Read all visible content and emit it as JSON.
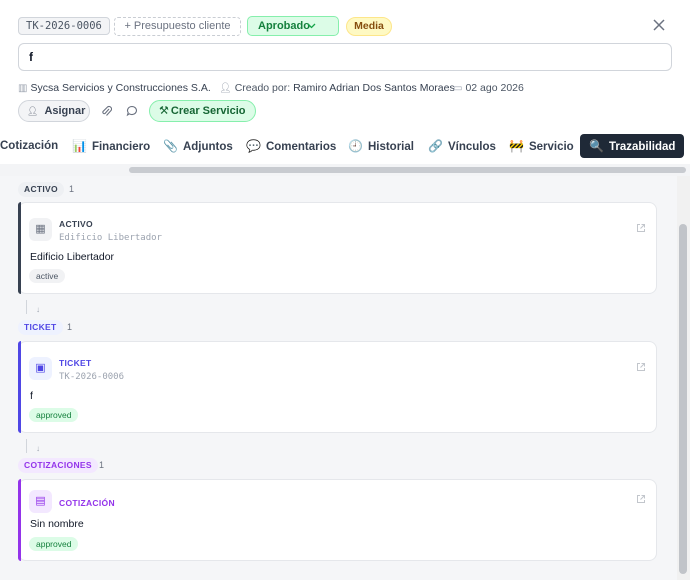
{
  "header": {
    "ticket_id": "TK-2026-0006",
    "budget_chip": "+ Presupuesto cliente",
    "status": "Aprobado",
    "priority": "Media",
    "title_value": "f",
    "company": "Sycsa Servicios y Construcciones S.A.",
    "created_by_label": "Creado por:",
    "created_by": "Ramiro Adrian Dos Santos Moraes",
    "date": "02 ago 2026",
    "assign_label": "Asignar",
    "create_service_label": "Crear Servicio"
  },
  "tabs": [
    {
      "label": "Cotización",
      "icon": ""
    },
    {
      "label": "Financiero",
      "icon": "📊"
    },
    {
      "label": "Adjuntos",
      "icon": "📎"
    },
    {
      "label": "Comentarios",
      "icon": "💬"
    },
    {
      "label": "Historial",
      "icon": "🕘"
    },
    {
      "label": "Vínculos",
      "icon": "🔗"
    },
    {
      "label": "Servicio",
      "icon": "🚧"
    },
    {
      "label": "Trazabilidad",
      "icon": "🔍"
    }
  ],
  "active_tab": "Trazabilidad",
  "sections": [
    {
      "label": "ACTIVO",
      "count": "1",
      "card": {
        "type": "ACTIVO",
        "code": "Edificio Libertador",
        "name": "Edificio Libertador",
        "badge": "active"
      }
    },
    {
      "label": "TICKET",
      "count": "1",
      "card": {
        "type": "TICKET",
        "code": "TK-2026-0006",
        "name": "f",
        "badge": "approved"
      }
    },
    {
      "label": "COTIZACIONES",
      "count": "1",
      "card": {
        "type": "COTIZACIÓN",
        "code": "",
        "name": "Sin nombre",
        "badge": "approved"
      }
    }
  ],
  "colors": {
    "activo": "#374151",
    "ticket": "#4f46e5",
    "cotizacion": "#9333ea",
    "approved_green": "#15803d"
  }
}
